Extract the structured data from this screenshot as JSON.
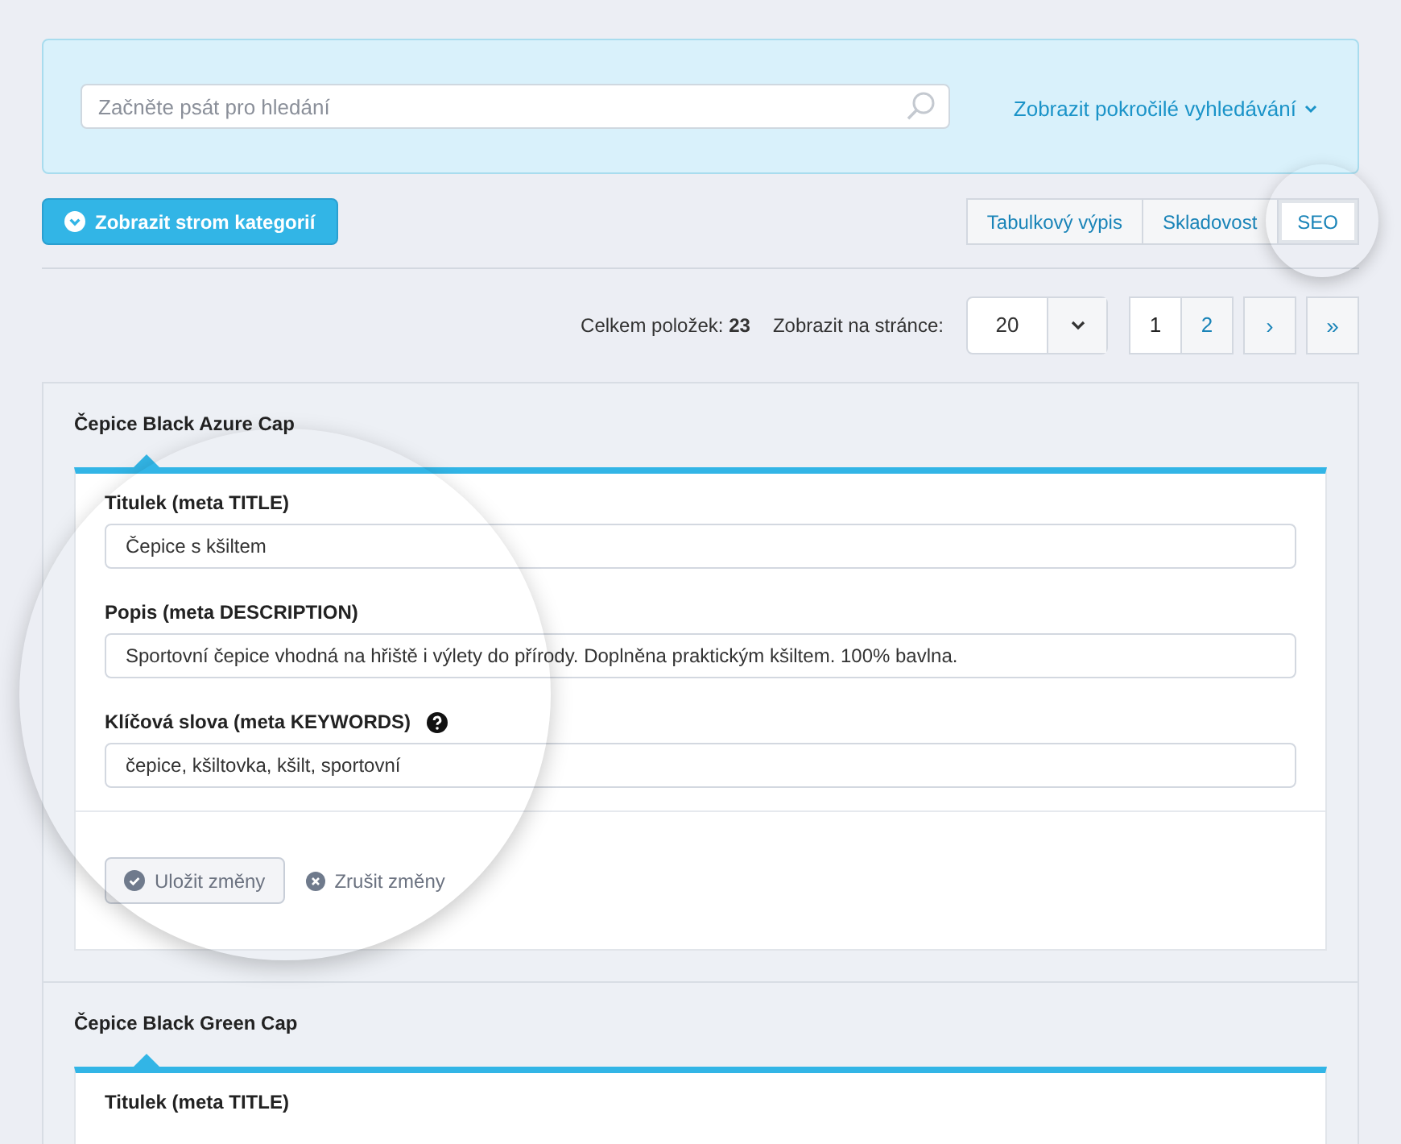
{
  "search": {
    "placeholder": "Začněte psát pro hledání",
    "advanced_link": "Zobrazit pokročilé vyhledávání"
  },
  "category_tree_button": "Zobrazit strom kategorií",
  "view_tabs": [
    {
      "label": "Tabulkový výpis",
      "selected": false
    },
    {
      "label": "Skladovost",
      "selected": false
    },
    {
      "label": "SEO",
      "selected": true
    }
  ],
  "summary": {
    "total_label": "Celkem položek:",
    "total_value": "23",
    "per_page_label": "Zobrazit na stránce:",
    "per_page_value": "20"
  },
  "pagination": {
    "pages": [
      {
        "label": "1",
        "selected": true
      },
      {
        "label": "2",
        "selected": false
      }
    ],
    "next": "›",
    "last": "»"
  },
  "products": [
    {
      "name": "Čepice Black Azure Cap",
      "fields": [
        {
          "label": "Titulek (meta TITLE)",
          "value": "Čepice s kšiltem",
          "help": false
        },
        {
          "label": "Popis (meta DESCRIPTION)",
          "value": "Sportovní čepice vhodná na hřiště i výlety do přírody. Doplněna praktickým kšiltem. 100% bavlna.",
          "help": false
        },
        {
          "label": "Klíčová slova (meta KEYWORDS)",
          "value": "čepice, kšiltovka, kšilt, sportovní",
          "help": true
        }
      ],
      "save_button": "Uložit změny",
      "cancel_button": "Zrušit změny"
    },
    {
      "name": "Čepice Black Green Cap",
      "fields": [
        {
          "label": "Titulek (meta TITLE)"
        }
      ]
    }
  ]
}
